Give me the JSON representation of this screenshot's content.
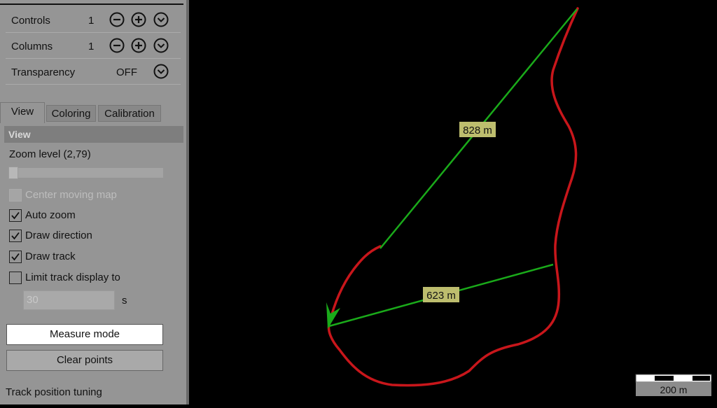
{
  "controls_panel": {
    "rows": [
      {
        "label": "Controls",
        "value": "1"
      },
      {
        "label": "Columns",
        "value": "1"
      },
      {
        "label": "Transparency",
        "value": "OFF"
      }
    ]
  },
  "tabs": [
    "View",
    "Coloring",
    "Calibration"
  ],
  "active_tab": "View",
  "view": {
    "header": "View",
    "zoom_label": "Zoom level (2,79)",
    "zoom_slider_fraction": 0.03,
    "checkboxes": [
      {
        "label": "Center moving map",
        "checked": false,
        "enabled": false
      },
      {
        "label": "Auto zoom",
        "checked": true,
        "enabled": true
      },
      {
        "label": "Draw direction",
        "checked": true,
        "enabled": true
      },
      {
        "label": "Draw track",
        "checked": true,
        "enabled": true
      },
      {
        "label": "Limit track display to",
        "checked": false,
        "enabled": true
      }
    ],
    "limit_value": "30",
    "limit_unit": "s",
    "measure_button": "Measure mode",
    "clear_button": "Clear points",
    "track_tuning": "Track position tuning"
  },
  "map": {
    "measurements": [
      "828 m",
      "623 m"
    ],
    "scale_label": "200 m",
    "colors": {
      "track": "#c8161b",
      "measure": "#1aaa1a",
      "label_bg": "#bdbd6e",
      "background": "#000000"
    }
  }
}
